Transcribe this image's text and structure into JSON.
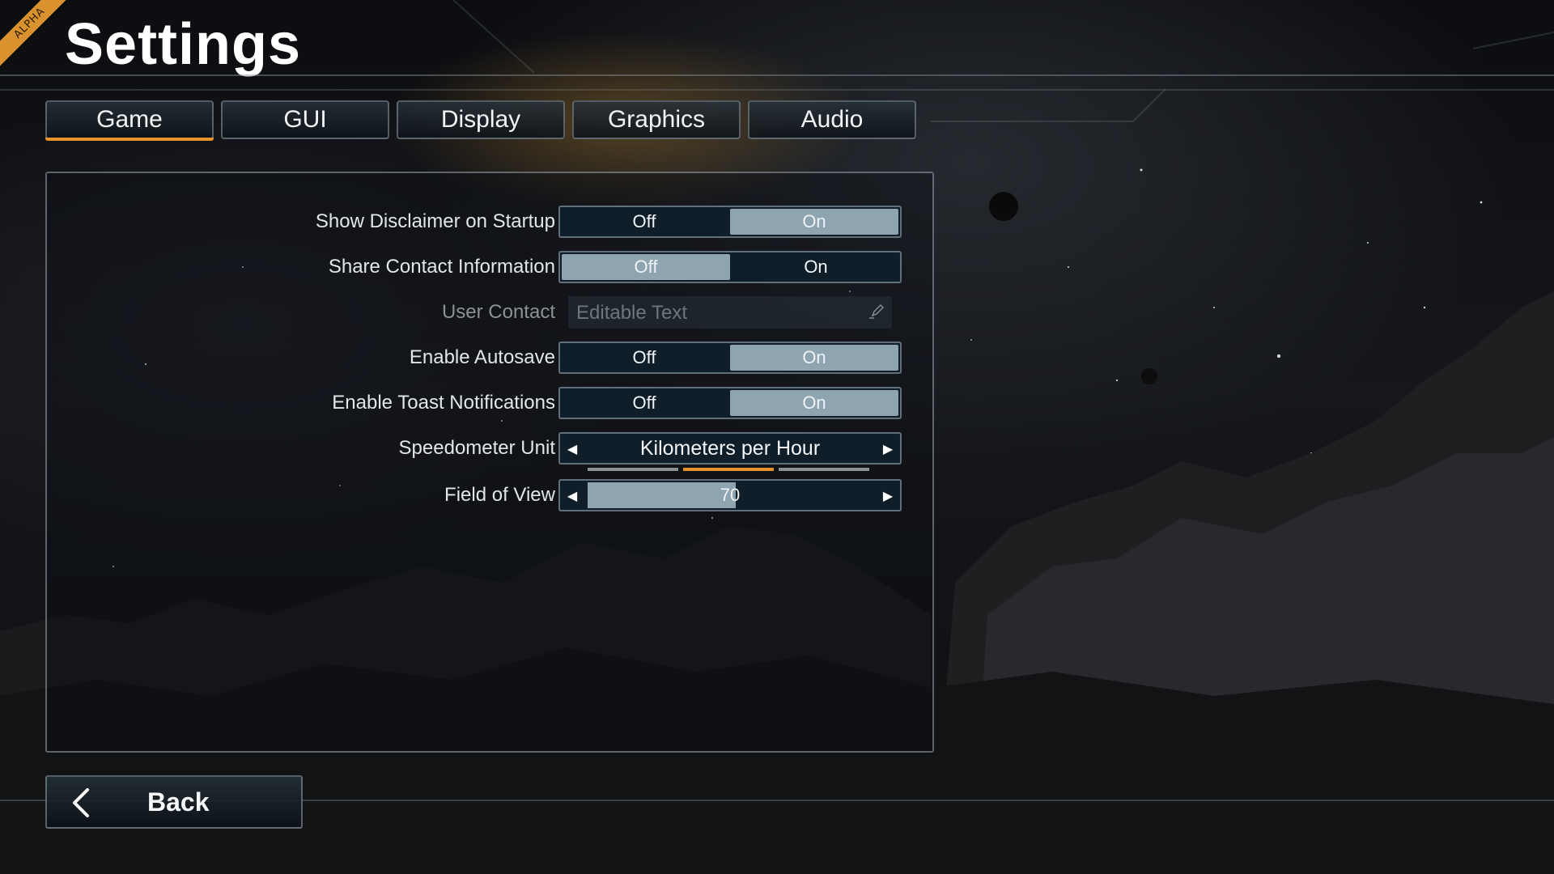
{
  "header": {
    "badge": "ALPHA",
    "title": "Settings"
  },
  "tabs": [
    {
      "label": "Game",
      "active": true
    },
    {
      "label": "GUI",
      "active": false
    },
    {
      "label": "Display",
      "active": false
    },
    {
      "label": "Graphics",
      "active": false
    },
    {
      "label": "Audio",
      "active": false
    }
  ],
  "settings": {
    "show_disclaimer": {
      "label": "Show Disclaimer on Startup",
      "off": "Off",
      "on": "On",
      "value": "On"
    },
    "share_contact": {
      "label": "Share Contact Information",
      "off": "Off",
      "on": "On",
      "value": "Off"
    },
    "user_contact": {
      "label": "User Contact",
      "value": "Editable Text",
      "icon": "pencil-icon",
      "disabled": true
    },
    "enable_autosave": {
      "label": "Enable Autosave",
      "off": "Off",
      "on": "On",
      "value": "On"
    },
    "enable_toast": {
      "label": "Enable Toast Notifications",
      "off": "Off",
      "on": "On",
      "value": "On"
    },
    "speedometer_unit": {
      "label": "Speedometer Unit",
      "value": "Kilometers per Hour",
      "option_count": 3,
      "selected_index": 1
    },
    "field_of_view": {
      "label": "Field of View",
      "value": "70",
      "fill_fraction": 0.52
    }
  },
  "footer": {
    "back_label": "Back",
    "back_icon": "chevron-left-icon"
  },
  "colors": {
    "accent": "#e8922e",
    "selected_option": "#8ea5b1",
    "control_bg": "#0f1e29"
  }
}
